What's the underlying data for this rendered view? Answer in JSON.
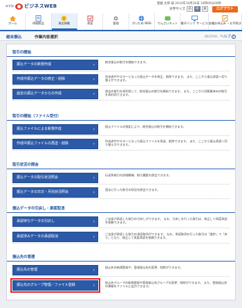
{
  "header": {
    "logo_prefix": "みずほ",
    "logo_text": "ビジネスWEB",
    "user_info": "愛媛 太郎 様  2014年10月30日 16時00分00秒",
    "font_size_label": "文字サイズ",
    "font_small": "小",
    "font_medium": "中",
    "font_large": "大",
    "logout_label": "ログアウト"
  },
  "nav": {
    "items": [
      {
        "label": "ホーム",
        "icon": "home-icon"
      },
      {
        "label": "明細照会",
        "icon": "statement-icon"
      },
      {
        "label": "資金移動",
        "icon": "transfer-icon"
      },
      {
        "label": "承認",
        "icon": "approval-icon"
      },
      {
        "label": "管理",
        "icon": "manage-icon"
      },
      {
        "label": "がいため WEB",
        "icon": "fx-icon"
      },
      {
        "label": "でんさいネット",
        "icon": "densai-icon"
      },
      {
        "label": "電子バンク サービス",
        "icon": "ebank-icon"
      },
      {
        "label": "各種お申込み ・お手続き",
        "icon": "application-icon"
      }
    ]
  },
  "subheader": {
    "breadcrumb": "総合振込",
    "page_title": "作業内容選択",
    "screen_id": "BSGF001",
    "help_label": "ヘルプ"
  },
  "sections": [
    {
      "title": "取引の開始",
      "rows": [
        {
          "button": "振込データの新規作成",
          "desc": "総合振込の取引を開始できます。"
        },
        {
          "button": "作成中振込データの修正・削除",
          "desc": "作成途中やエラーとなった振込データを修正、削除できます。 また、ここから振込承認へ切り替えができます。"
        },
        {
          "button": "過去の振込データからの作成",
          "desc": "過去の取引を再利用して、総合振込の取引を開始できます。 また、ここから切替業済みの取引を再利用できます。"
        }
      ]
    },
    {
      "title": "取引の開始（ファイル受付）",
      "rows": [
        {
          "button": "振込ファイルによる新規作成",
          "desc": "振込ファイルの指定により、総合振込の取引を開始できます。"
        },
        {
          "button": "作成中振込ファイルの再送・削除",
          "desc": "作成途中やエラーとなった振込ファイルを再送、削除できます。 また、ここから振込承認へ切り替えができます。"
        }
      ]
    },
    {
      "title": "取引状況の照会",
      "rows": [
        {
          "button": "振込データの取引状況照会",
          "desc": "伝送系取引の詳細情報、取引履歴を照会できます。"
        },
        {
          "button": "振込データの日次・月別状況照会",
          "desc": "過去に行った取引の状況を照会できます。"
        }
      ]
    },
    {
      "title": "振込データの引戻し・承認取消",
      "rows": [
        {
          "button": "承認待ちデータの引戻し",
          "desc": "ご自身が承認した取引の引戻しができます。 なお、引戻しを行った取引は、修正して再度承認を依頼できます。"
        },
        {
          "button": "承認済みデータの承認取消",
          "desc": "ご自身が承認した取引の承認取消ができます。 なお、承認取消を行った取引は「進捗」で「戻り」となり、修正して再度承認を依頼できます。"
        }
      ]
    },
    {
      "title": "振込先の管理",
      "rows": [
        {
          "button": "振込先の管理",
          "desc": "振込先の新規登録や、登録振込先の変更、削除ができます。"
        },
        {
          "button": "振込先のグループ管理／ファイル登録",
          "desc": "振込先グループの新規登録や登録振込先グループの変更、削除ができます。 また、登録振込先の情報をファイルに出力できます。"
        }
      ]
    }
  ]
}
